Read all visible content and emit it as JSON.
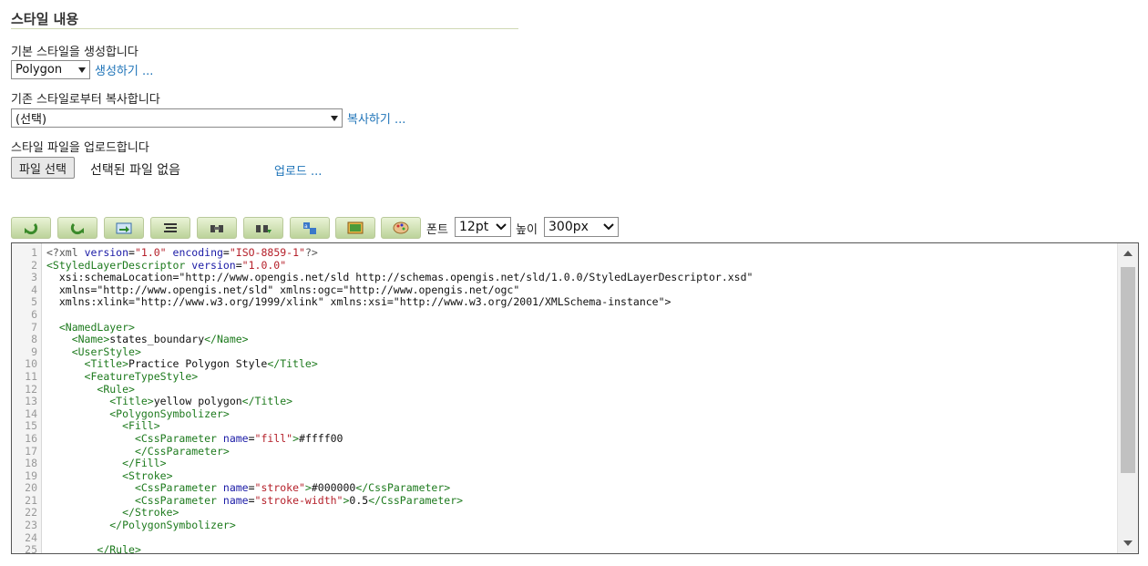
{
  "section": {
    "title": "스타일 내용"
  },
  "create": {
    "label": "기본 스타일을 생성합니다",
    "select_value": "Polygon",
    "link": "생성하기 ..."
  },
  "copy": {
    "label": "기존 스타일로부터 복사합니다",
    "select_value": "(선택)",
    "link": "복사하기 ..."
  },
  "upload": {
    "label": "스타일 파일을 업로드합니다",
    "file_button": "파일 선택",
    "file_status": "선택된 파일 없음",
    "link": "업로드 ..."
  },
  "toolbar": {
    "buttons": [
      "undo-icon",
      "redo-icon",
      "go-to-line-icon",
      "reformat-icon",
      "find-icon",
      "replace-icon",
      "color-mode-icon",
      "preview-icon",
      "palette-icon"
    ],
    "font_label": "폰트",
    "font_value": "12pt",
    "height_label": "높이",
    "height_value": "300px"
  },
  "editor": {
    "lines": [
      "<?xml version=\"1.0\" encoding=\"ISO-8859-1\"?>",
      "<StyledLayerDescriptor version=\"1.0.0\"",
      "  xsi:schemaLocation=\"http://www.opengis.net/sld http://schemas.opengis.net/sld/1.0.0/StyledLayerDescriptor.xsd\"",
      "  xmlns=\"http://www.opengis.net/sld\" xmlns:ogc=\"http://www.opengis.net/ogc\"",
      "  xmlns:xlink=\"http://www.w3.org/1999/xlink\" xmlns:xsi=\"http://www.w3.org/2001/XMLSchema-instance\">",
      "",
      "  <NamedLayer>",
      "    <Name>states_boundary</Name>",
      "    <UserStyle>",
      "      <Title>Practice Polygon Style</Title>",
      "      <FeatureTypeStyle>",
      "        <Rule>",
      "          <Title>yellow polygon</Title>",
      "          <PolygonSymbolizer>",
      "            <Fill>",
      "              <CssParameter name=\"fill\">#ffff00",
      "              </CssParameter>",
      "            </Fill>",
      "            <Stroke>",
      "              <CssParameter name=\"stroke\">#000000</CssParameter>",
      "              <CssParameter name=\"stroke-width\">0.5</CssParameter>",
      "            </Stroke>",
      "          </PolygonSymbolizer>",
      "",
      "        </Rule>"
    ]
  }
}
